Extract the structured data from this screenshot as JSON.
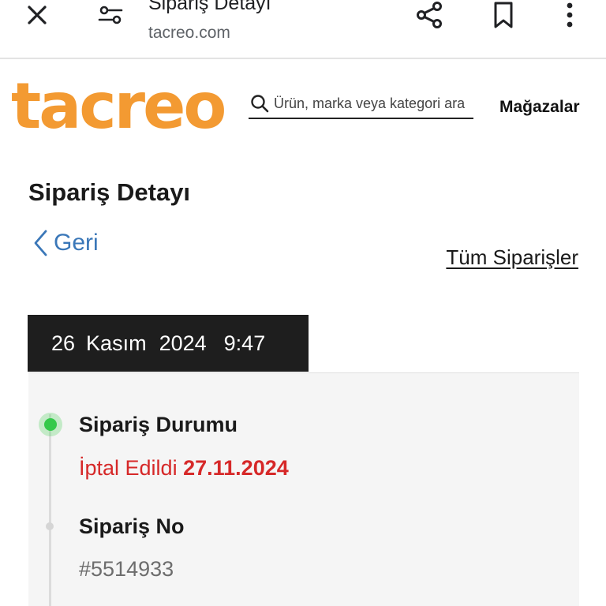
{
  "browser": {
    "title": "Sipariş Detayı",
    "url": "tacreo.com",
    "icons": [
      "close-icon",
      "tune-icon",
      "share-icon",
      "bookmark-icon",
      "more-vert-icon"
    ]
  },
  "header": {
    "logo_text": "tacreo",
    "logo_color": "#f39a32",
    "search_placeholder": "Ürün, marka veya kategori ara",
    "stores_label": "Mağazalar"
  },
  "page": {
    "title": "Sipariş Detayı",
    "back_label": "Geri",
    "all_orders_label": "Tüm Siparişler"
  },
  "order": {
    "date": {
      "day": "26",
      "month": "Kasım",
      "year": "2024",
      "time": "9:47"
    },
    "status_label": "Sipariş Durumu",
    "status_text": "İptal Edildi",
    "status_date": "27.11.2024",
    "status_color": "#d62828",
    "order_no_label": "Sipariş No",
    "order_no": "#5514933"
  }
}
